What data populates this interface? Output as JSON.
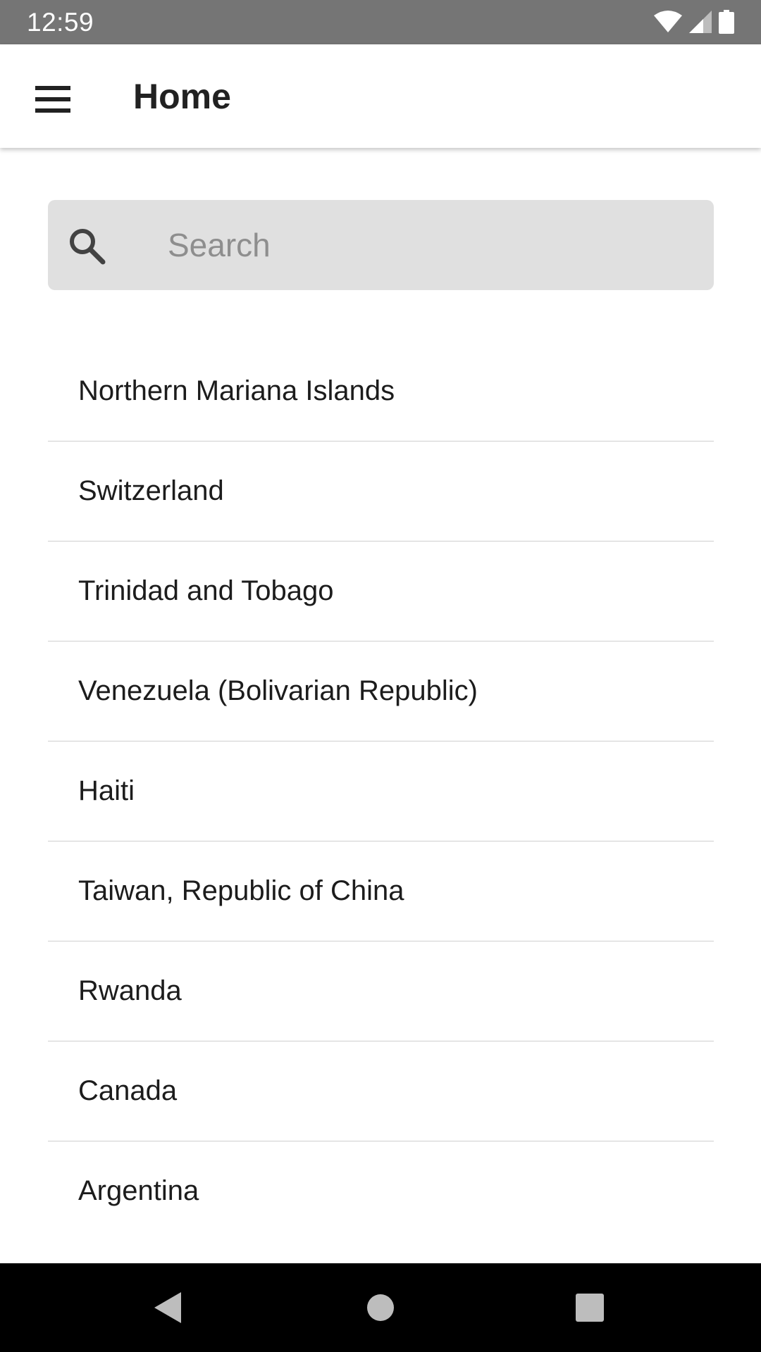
{
  "status_bar": {
    "time": "12:59",
    "icons": [
      "wifi-icon",
      "cellular-signal-icon",
      "battery-icon"
    ]
  },
  "app_bar": {
    "title": "Home",
    "menu_icon": "hamburger-menu-icon"
  },
  "search": {
    "placeholder": "Search",
    "value": "",
    "icon": "search-icon"
  },
  "countries": [
    "Northern Mariana Islands",
    "Switzerland",
    "Trinidad and Tobago",
    "Venezuela (Bolivarian Republic)",
    "Haiti",
    "Taiwan, Republic of China",
    "Rwanda",
    "Canada",
    "Argentina"
  ],
  "nav_bar": {
    "buttons": [
      "back-icon",
      "home-icon",
      "recents-icon"
    ]
  },
  "colors": {
    "status_bar_bg": "#757575",
    "search_bg": "#e0e0e0",
    "nav_bar_bg": "#000000",
    "divider": "#cfcfcf"
  }
}
